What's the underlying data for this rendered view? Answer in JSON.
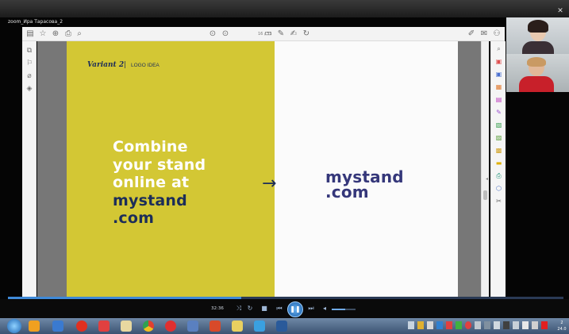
{
  "window": {
    "title": "zoom_Ира Тарасова_2"
  },
  "toolbar": {
    "page_indicator": "16 / 31"
  },
  "slide": {
    "variant_label": "Variant 2",
    "separator": "|",
    "logo_idea_label": "LOGO IDEA",
    "headline_white": [
      "Combine",
      "your stand",
      "online at"
    ],
    "headline_navy": [
      "mystand",
      ".com"
    ],
    "arrow": "→",
    "logo_line1": "mystand",
    "logo_line2": ".com",
    "colors": {
      "yellow": "#d3c734",
      "navy": "#1c2d59",
      "logo_purple": "#35377a"
    }
  },
  "player": {
    "time": "32:36",
    "progress": 0.42,
    "volume": 0.55
  },
  "taskbar": {
    "clock_line1": "2",
    "clock_line2": "24.0"
  }
}
